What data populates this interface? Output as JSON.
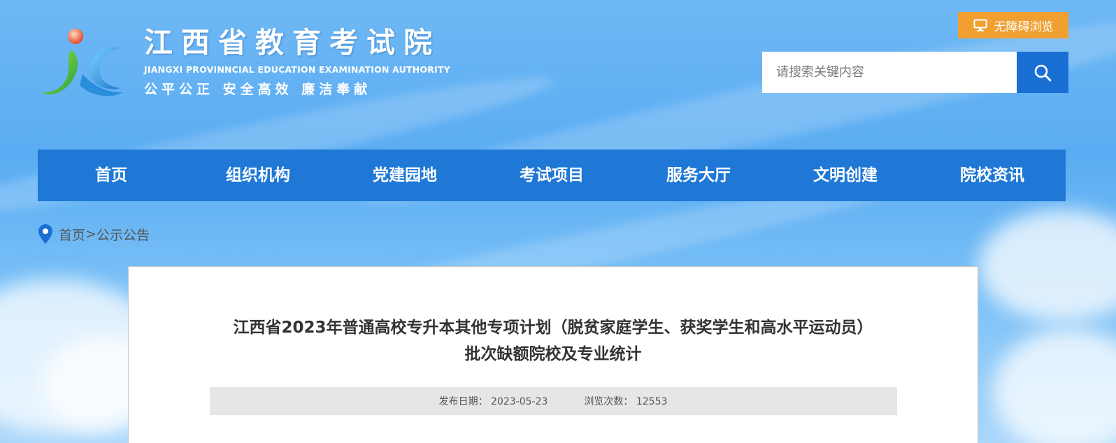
{
  "header": {
    "site_title": "江西省教育考试院",
    "site_title_en": "JIANGXI PROVINNCIAL EDUCATION EXAMINATION AUTHORITY",
    "motto": "公平公正 安全高效 廉洁奉献",
    "accessibility_label": "无障碍浏览",
    "search_placeholder": "请搜索关键内容"
  },
  "nav": {
    "items": [
      "首页",
      "组织机构",
      "党建园地",
      "考试项目",
      "服务大厅",
      "文明创建",
      "院校资讯"
    ]
  },
  "breadcrumb": {
    "home": "首页",
    "separator": ">",
    "current": "公示公告"
  },
  "article": {
    "title_line1": "江西省2023年普通高校专升本其他专项计划（脱贫家庭学生、获奖学生和高水平运动员）",
    "title_line2": "批次缺额院校及专业统计",
    "publish_label": "发布日期：",
    "publish_date": "2023-05-23",
    "views_label": "浏览次数：",
    "views": "12553"
  },
  "colors": {
    "nav_bg": "#1f78d6",
    "search_button": "#1a6fd4",
    "accessibility_button": "#f0a031",
    "meta_bg": "#e6e6e6"
  },
  "icons": [
    "logo-icon",
    "monitor-icon",
    "search-icon",
    "location-pin-icon"
  ]
}
